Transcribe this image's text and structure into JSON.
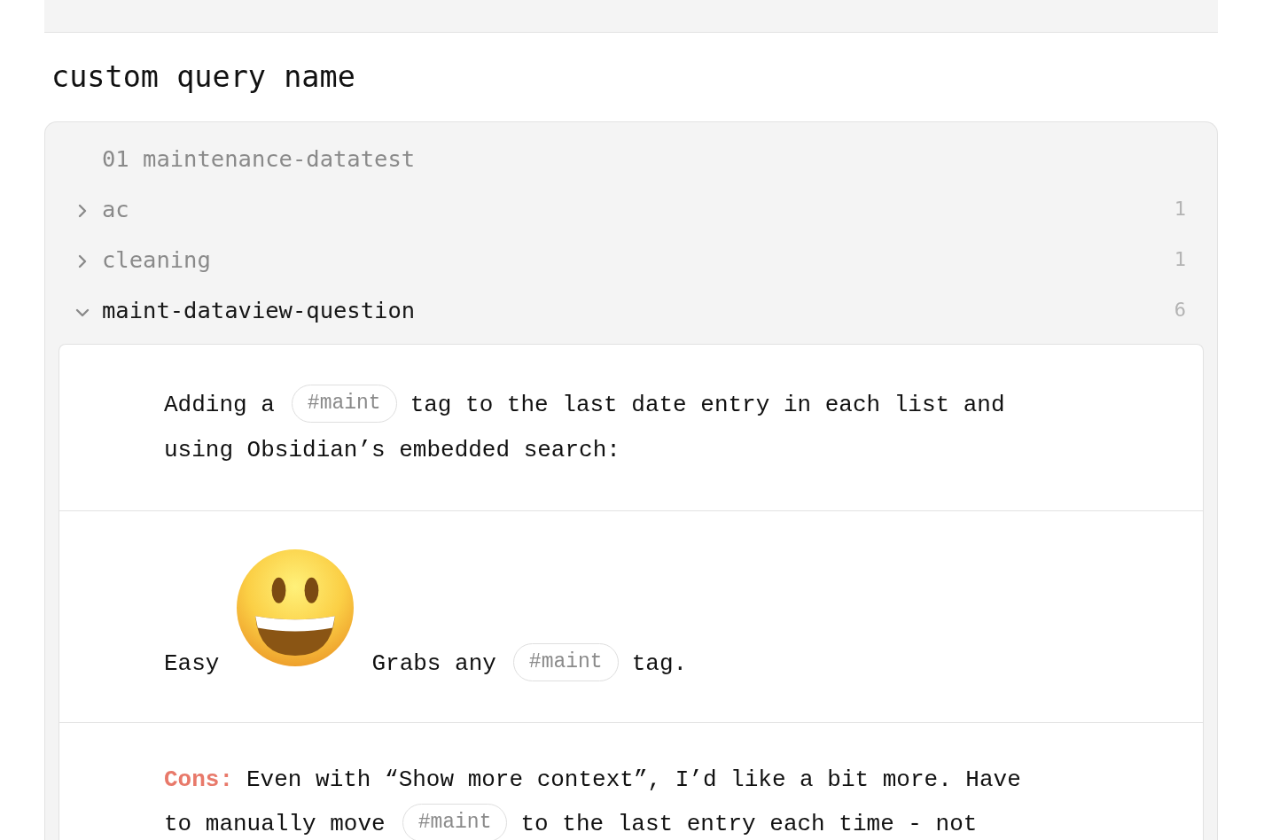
{
  "heading": "custom query name",
  "results": {
    "file": "01 maintenance-datatest",
    "groups": [
      {
        "label": "ac",
        "count": "1",
        "expanded": false
      },
      {
        "label": "cleaning",
        "count": "1",
        "expanded": false
      },
      {
        "label": "maint-dataview-question",
        "count": "6",
        "expanded": true,
        "matches": [
          {
            "lines": [
              {
                "segments": [
                  {
                    "kind": "text",
                    "text": "Adding a"
                  },
                  {
                    "kind": "tag",
                    "text": "#maint"
                  },
                  {
                    "kind": "text",
                    "text": "tag to the last date entry in each list and"
                  }
                ]
              },
              {
                "segments": [
                  {
                    "kind": "text",
                    "text": "using Obsidian’s embedded search:"
                  }
                ]
              }
            ]
          },
          {
            "lines": [
              {
                "segments": [
                  {
                    "kind": "text",
                    "text": "Easy"
                  },
                  {
                    "kind": "emoji"
                  },
                  {
                    "kind": "text",
                    "text": "Grabs any"
                  },
                  {
                    "kind": "tag",
                    "text": "#maint"
                  },
                  {
                    "kind": "text",
                    "text": "tag."
                  }
                ]
              }
            ]
          },
          {
            "lines": [
              {
                "segments": [
                  {
                    "kind": "label",
                    "text": "Cons:"
                  },
                  {
                    "kind": "text",
                    "text": "Even with “Show more context”, I’d like a bit more. Have"
                  }
                ]
              },
              {
                "segments": [
                  {
                    "kind": "text",
                    "text": "to manually move"
                  },
                  {
                    "kind": "tag",
                    "text": "#maint"
                  },
                  {
                    "kind": "text",
                    "text": "to the last entry each time - not"
                  }
                ]
              }
            ]
          }
        ]
      }
    ]
  }
}
